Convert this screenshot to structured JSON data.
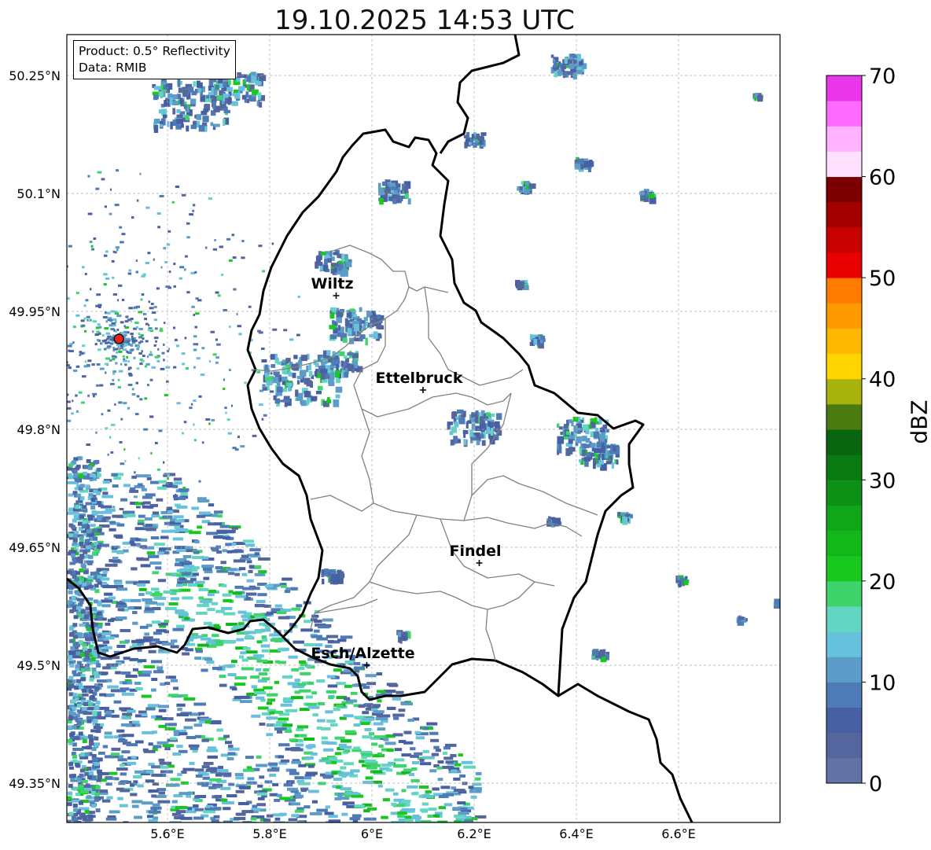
{
  "title": "19.10.2025 14:53 UTC",
  "info": {
    "product": "Product: 0.5° Reflectivity",
    "source": "Data: RMIB"
  },
  "axes": {
    "lon_ticks": [
      "5.6°E",
      "5.8°E",
      "6°E",
      "6.2°E",
      "6.4°E",
      "6.6°E"
    ],
    "lat_ticks": [
      "50.25°N",
      "50.1°N",
      "49.95°N",
      "49.8°N",
      "49.65°N",
      "49.5°N",
      "49.35°N"
    ]
  },
  "cities": [
    {
      "name": "Wiltz",
      "lon": 5.93,
      "lat": 49.97
    },
    {
      "name": "Ettelbruck",
      "lon": 6.1,
      "lat": 49.85
    },
    {
      "name": "Findel",
      "lon": 6.21,
      "lat": 49.63
    },
    {
      "name": "Esch/Alzette",
      "lon": 5.99,
      "lat": 49.5
    }
  ],
  "radar_site": {
    "lon": 5.505,
    "lat": 49.915
  },
  "colorbar": {
    "title": "dBZ",
    "ticks": [
      "0",
      "10",
      "20",
      "30",
      "40",
      "50",
      "60",
      "70"
    ],
    "colors": [
      "#6272a4",
      "#55659e",
      "#4760a3",
      "#4e7ab5",
      "#5b9cc8",
      "#67c0dc",
      "#62d6c2",
      "#3fd46b",
      "#18c81e",
      "#12b81a",
      "#10a618",
      "#0e8f15",
      "#0c7a12",
      "#0a6510",
      "#4a7a10",
      "#a8b20c",
      "#ffd500",
      "#ffb800",
      "#ff9900",
      "#ff7b00",
      "#e80000",
      "#c70000",
      "#a30000",
      "#7d0000",
      "#ffe0ff",
      "#ffb2ff",
      "#ff6bff",
      "#ea36ea"
    ]
  }
}
